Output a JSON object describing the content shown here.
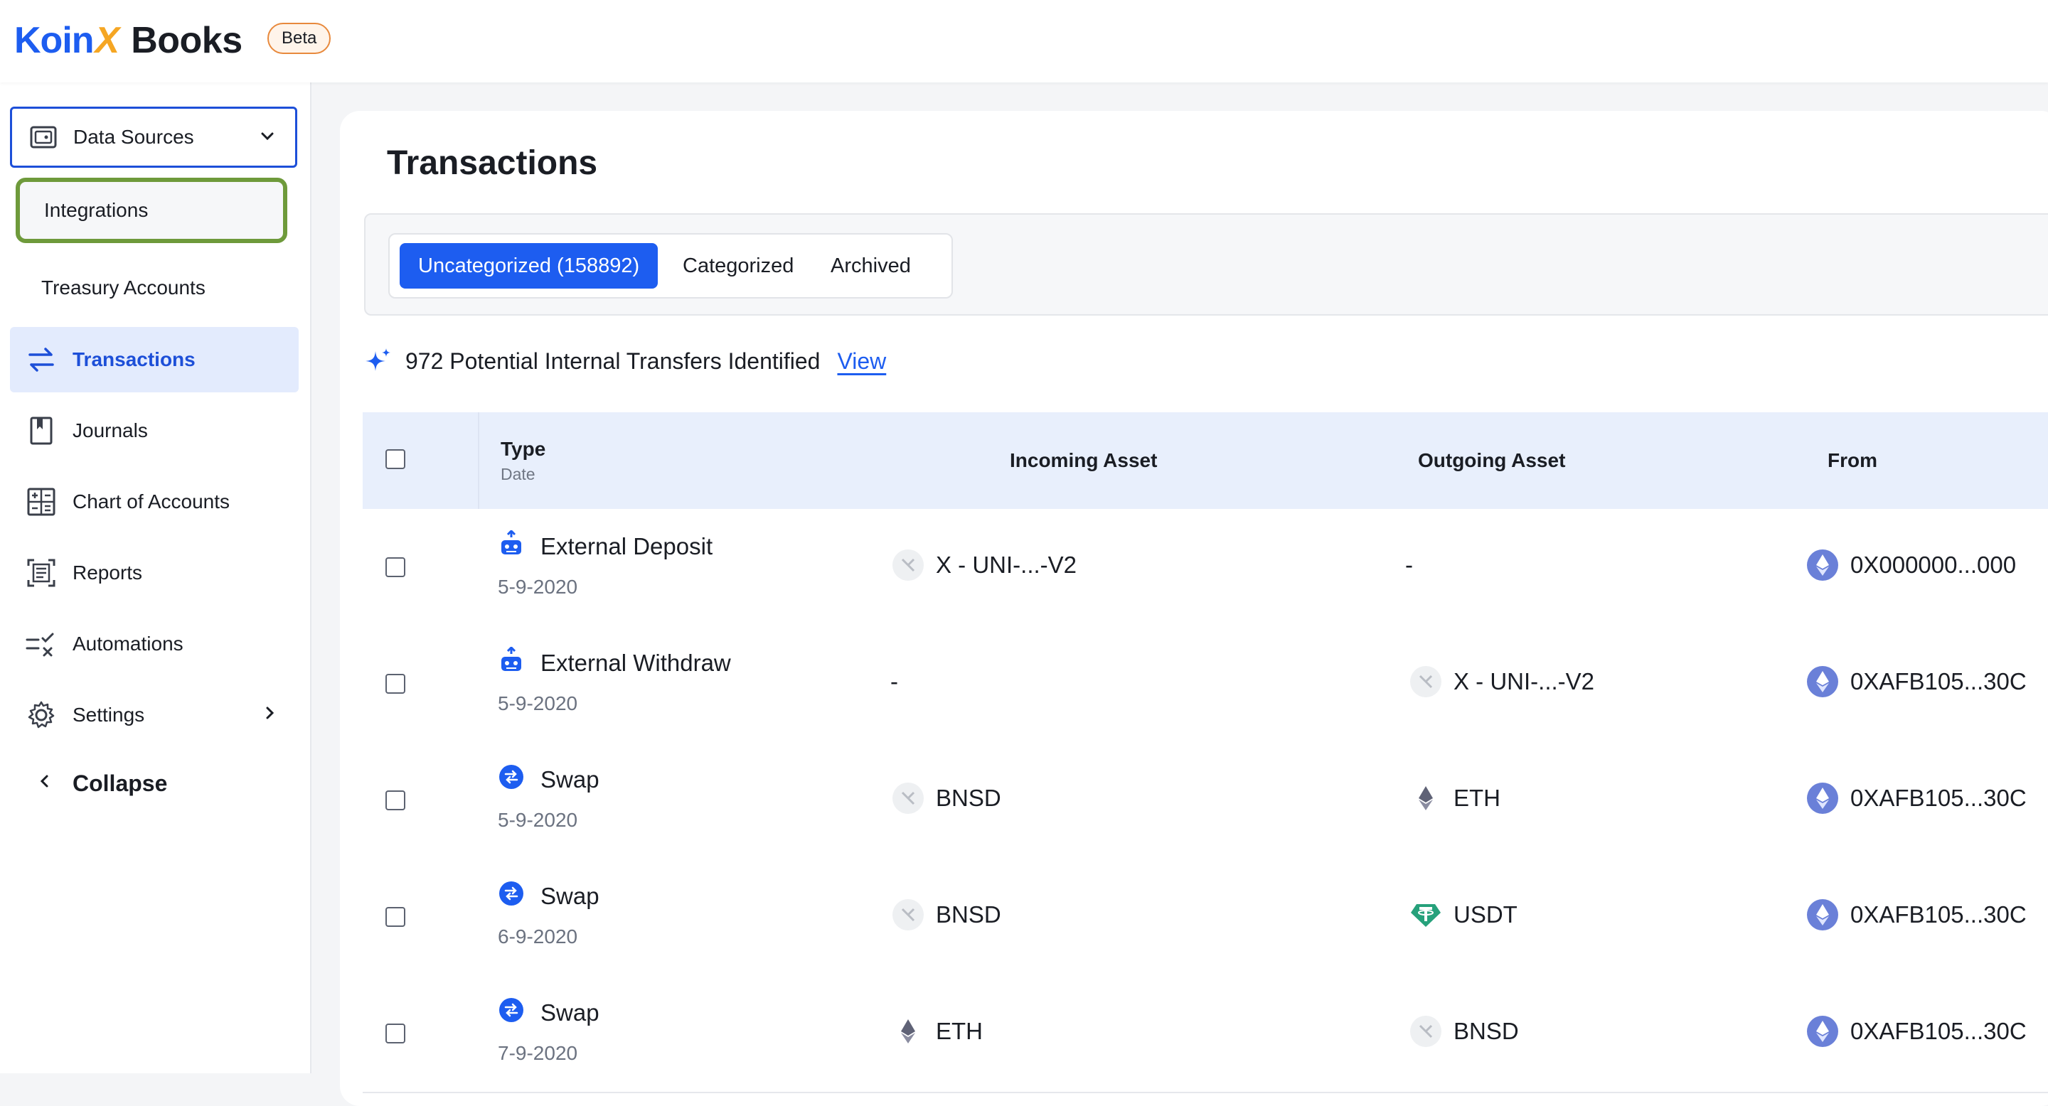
{
  "brand": {
    "koin": "Koin",
    "x": "X",
    "books": "Books",
    "badge": "Beta"
  },
  "sidebar": {
    "data_sources": "Data Sources",
    "sub_items": [
      "Integrations",
      "Treasury Accounts"
    ],
    "nav": [
      {
        "label": "Transactions",
        "icon": "arrows-swap-icon",
        "active": true
      },
      {
        "label": "Journals",
        "icon": "bookmark-book-icon"
      },
      {
        "label": "Chart of Accounts",
        "icon": "calculator-icon"
      },
      {
        "label": "Reports",
        "icon": "report-document-icon"
      },
      {
        "label": "Automations",
        "icon": "automation-list-icon"
      },
      {
        "label": "Settings",
        "icon": "gear-icon"
      }
    ],
    "collapse": "Collapse"
  },
  "main": {
    "title": "Transactions",
    "tabs": [
      "Uncategorized (158892)",
      "Categorized",
      "Archived"
    ],
    "transfers": {
      "text": "972 Potential Internal Transfers Identified",
      "link": "View"
    },
    "table": {
      "headers": {
        "type": "Type",
        "date": "Date",
        "incoming": "Incoming Asset",
        "outgoing": "Outgoing Asset",
        "from": "From"
      },
      "rows": [
        {
          "type": "External Deposit",
          "date": "5-9-2020",
          "incoming": "X - UNI-...-V2",
          "outgoing": "-",
          "from": "0X000000...000"
        },
        {
          "type": "External Withdraw",
          "date": "5-9-2020",
          "incoming": "-",
          "outgoing": "X - UNI-...-V2",
          "from": "0XAFB105...30C"
        },
        {
          "type": "Swap",
          "date": "5-9-2020",
          "incoming": "BNSD",
          "outgoing": "ETH",
          "from": "0XAFB105...30C"
        },
        {
          "type": "Swap",
          "date": "6-9-2020",
          "incoming": "BNSD",
          "outgoing": "USDT",
          "from": "0XAFB105...30C"
        },
        {
          "type": "Swap",
          "date": "7-9-2020",
          "incoming": "ETH",
          "outgoing": "BNSD",
          "from": "0XAFB105...30C"
        }
      ]
    }
  },
  "colors": {
    "brand_blue": "#1d5df0",
    "brand_orange": "#f5a623",
    "highlight_green": "#6e9a3b",
    "header_bg": "#e8effc"
  }
}
